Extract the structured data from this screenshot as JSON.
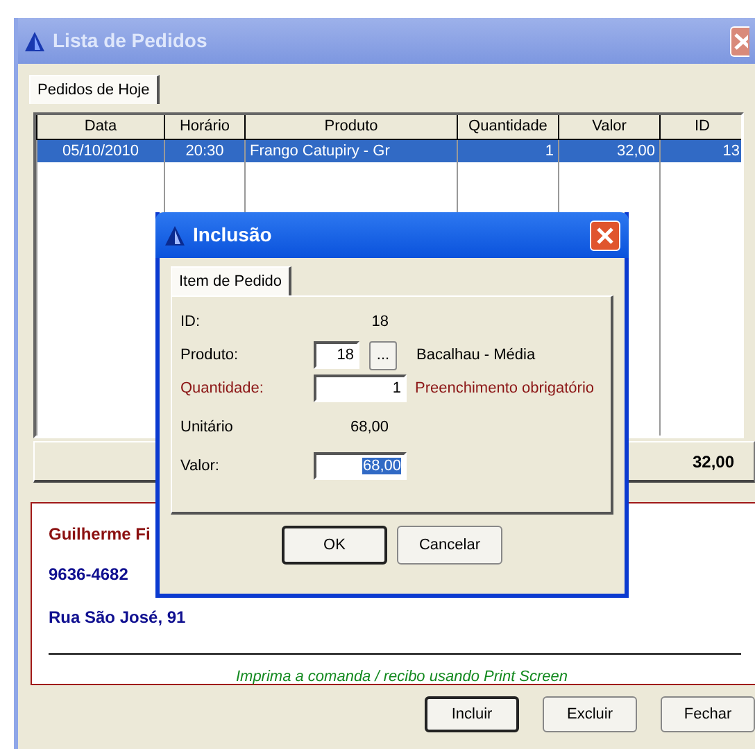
{
  "window": {
    "title": "Lista de Pedidos"
  },
  "tabs": [
    {
      "label": "Pedidos de Hoje",
      "selected": true
    }
  ],
  "table": {
    "columns": [
      "Data",
      "Horário",
      "Produto",
      "Quantidade",
      "Valor",
      "ID"
    ],
    "rows": [
      {
        "cells": [
          "05/10/2010",
          "20:30",
          "Frango Catupiry - Gr",
          "1",
          "32,00",
          "13"
        ],
        "selected": true
      }
    ]
  },
  "total": "32,00",
  "customer": {
    "name": "Guilherme Fi",
    "phone": "9636-4682",
    "address": "Rua São José, 91",
    "note": "Imprima a comanda / recibo usando Print Screen"
  },
  "buttons": [
    {
      "label": "Incluir",
      "default": true
    },
    {
      "label": "Excluir",
      "default": false
    },
    {
      "label": "Fechar",
      "default": false
    }
  ],
  "dialog": {
    "title": "Inclusão",
    "tabs": [
      {
        "label": "Item de Pedido",
        "selected": true
      }
    ],
    "fields": [
      {
        "kind": "display",
        "label": "ID:",
        "value": "18"
      },
      {
        "kind": "lookup",
        "label": "Produto:",
        "value": "18",
        "button": "...",
        "description": "Bacalhau - Média"
      },
      {
        "kind": "input",
        "label": "Quantidade:",
        "value": "1",
        "invalid": true,
        "message": "Preenchimento obrigatório",
        "text_selected": false
      },
      {
        "kind": "display",
        "label": "Unitário",
        "value": "68,00"
      },
      {
        "kind": "input",
        "label": "Valor:",
        "value": "68,00",
        "invalid": false,
        "text_selected": true
      }
    ],
    "buttons": [
      {
        "label": "OK",
        "default": true
      },
      {
        "label": "Cancelar",
        "default": false
      }
    ]
  }
}
